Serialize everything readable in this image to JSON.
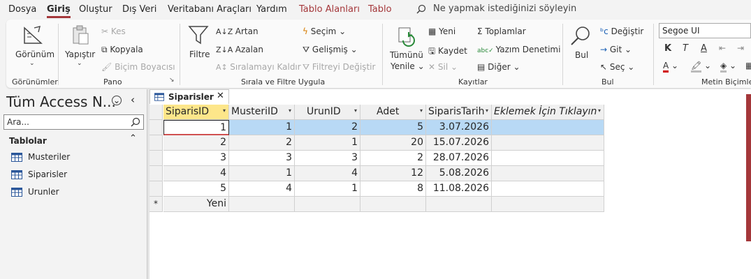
{
  "menu": {
    "tabs": [
      "Dosya",
      "Giriş",
      "Oluştur",
      "Dış Veri",
      "Veritabanı Araçları",
      "Yardım",
      "Tablo Alanları",
      "Tablo"
    ],
    "active": "Giriş",
    "tell_me": "Ne yapmak istediğinizi söyleyin"
  },
  "ribbon": {
    "groups": {
      "views": "Görünümler",
      "clipboard": "Pano",
      "sort_filter": "Sırala ve Filtre Uygula",
      "records": "Kayıtlar",
      "find": "Bul",
      "text_format": "Metin Biçimle"
    },
    "view_label": "Görünüm",
    "paste_label": "Yapıştır",
    "cut": "Kes",
    "copy": "Kopyala",
    "format_painter": "Biçim Boyacısı",
    "filter": "Filtre",
    "ascending": "Artan",
    "descending": "Azalan",
    "remove_sort": "Sıralamayı Kaldır",
    "selection": "Seçim",
    "advanced": "Gelişmiş",
    "toggle_filter": "Filtreyi Değiştir",
    "refresh_all_1": "Tümünü",
    "refresh_all_2": "Yenile",
    "new": "Yeni",
    "save": "Kaydet",
    "delete": "Sil",
    "totals": "Toplamlar",
    "spelling": "Yazım Denetimi",
    "more": "Diğer",
    "find_label": "Bul",
    "replace": "Değiştir",
    "goto": "Git",
    "select": "Seç",
    "font_name": "Segoe UI",
    "bold": "K",
    "italic": "T",
    "underline": "A"
  },
  "nav": {
    "title": "Tüm Access N...",
    "search_placeholder": "Ara...",
    "section": "Tablolar",
    "items": [
      "Musteriler",
      "Siparisler",
      "Urunler"
    ]
  },
  "document": {
    "tab_label": "Siparisler",
    "columns": [
      "SiparisID",
      "MusteriID",
      "UrunID",
      "Adet",
      "SiparisTarih",
      "Eklemek İçin Tıklayın"
    ],
    "rows": [
      [
        "1",
        "1",
        "2",
        "5",
        "3.07.2026"
      ],
      [
        "2",
        "2",
        "1",
        "20",
        "15.07.2026"
      ],
      [
        "3",
        "3",
        "3",
        "2",
        "28.07.2026"
      ],
      [
        "4",
        "1",
        "4",
        "12",
        "5.08.2026"
      ],
      [
        "5",
        "4",
        "1",
        "8",
        "11.08.2026"
      ]
    ],
    "new_row_label": "Yeni",
    "new_row_marker": "*"
  },
  "colors": {
    "accent": "#a4373a",
    "selected_row": "#b8d9f5",
    "selected_header": "#fde68a"
  }
}
